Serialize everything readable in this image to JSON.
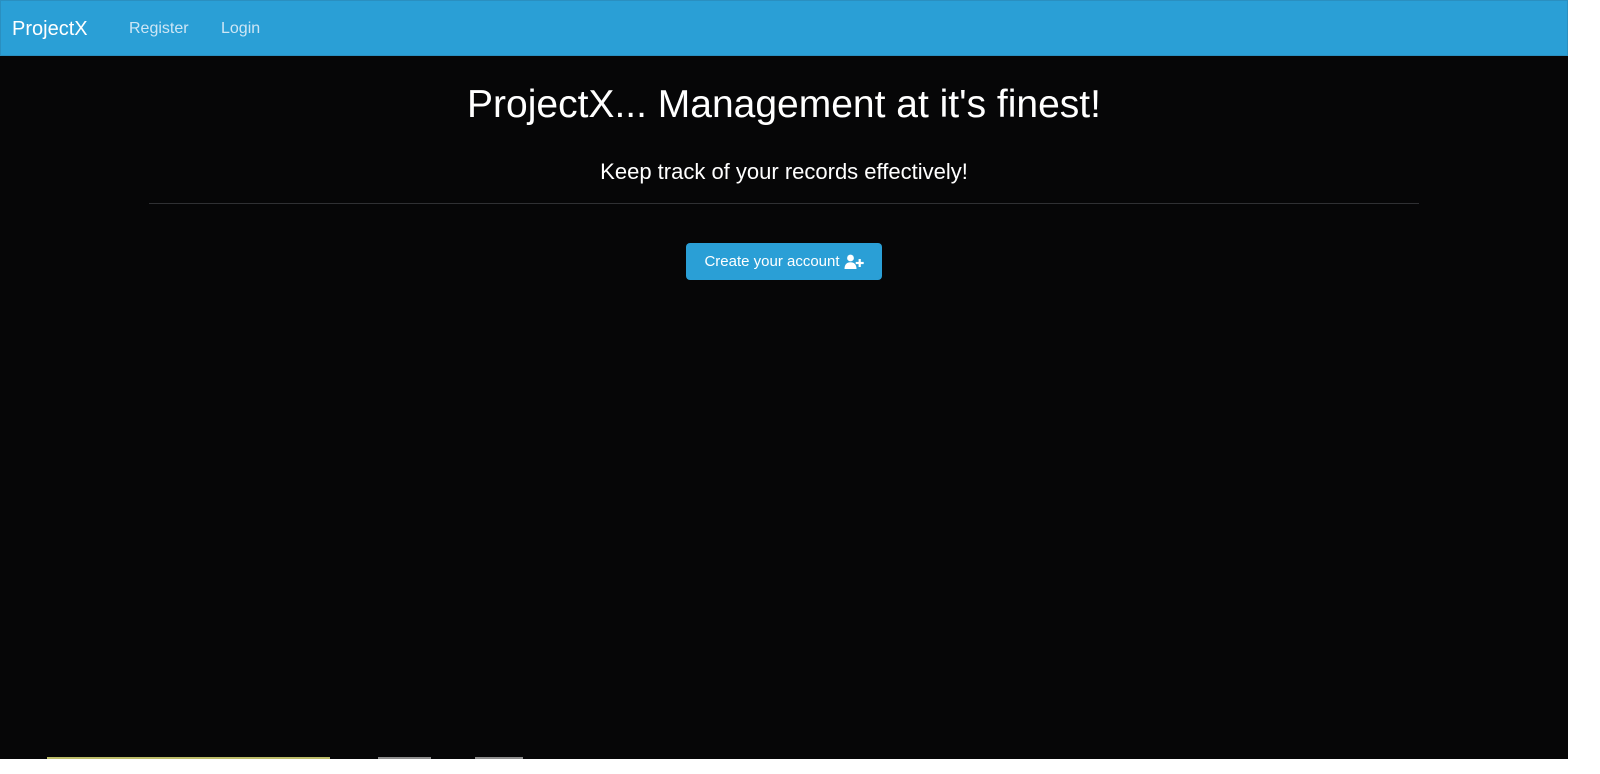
{
  "navbar": {
    "brand": "ProjectX",
    "links": [
      {
        "label": "Register"
      },
      {
        "label": "Login"
      }
    ]
  },
  "hero": {
    "title": "ProjectX... Management at it's finest!",
    "subtitle": "Keep track of your records effectively!",
    "cta_label": "Create your account",
    "cta_icon": "user-plus-icon"
  },
  "colors": {
    "primary": "#2a9fd6",
    "background": "#060607",
    "text": "#ffffff",
    "nav_link": "#cde6f5",
    "divider": "#2f3033"
  }
}
